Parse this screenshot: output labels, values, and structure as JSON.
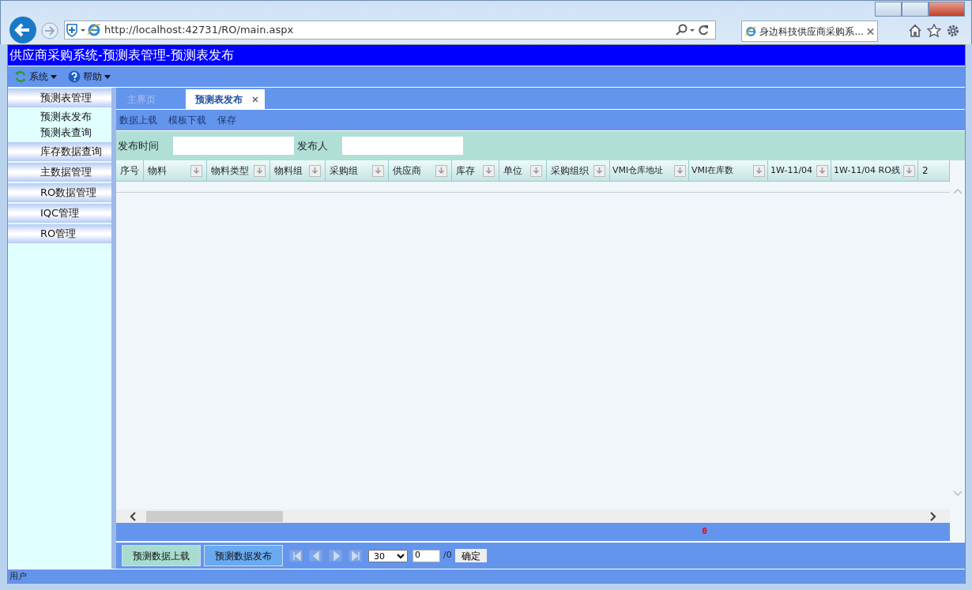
{
  "browser": {
    "url": "http://localhost:42731/RO/main.aspx",
    "tab_title": "身边科技供应商采购系..."
  },
  "app_title": "供应商采购系统-预测表管理-预测表发布",
  "menu": [
    {
      "label": "系统",
      "kind": "refresh"
    },
    {
      "label": "帮助",
      "kind": "help"
    }
  ],
  "sidebar": [
    {
      "label": "预测表管理",
      "children": [
        {
          "label": "预测表发布"
        },
        {
          "label": "预测表查询"
        }
      ]
    },
    {
      "label": "库存数据查询"
    },
    {
      "label": "主数据管理"
    },
    {
      "label": "RO数据管理"
    },
    {
      "label": "IQC管理"
    },
    {
      "label": "RO管理"
    }
  ],
  "tabs": [
    {
      "label": "主界页",
      "selected": false,
      "closable": false
    },
    {
      "label": "预测表发布",
      "selected": true,
      "closable": true
    }
  ],
  "toolbar": [
    "数据上载",
    "模板下载",
    "保存"
  ],
  "filters": [
    {
      "label": "发布时间"
    },
    {
      "label": "发布人"
    }
  ],
  "columns": [
    {
      "label": "序号",
      "has_menu": false
    },
    {
      "label": "物料",
      "has_menu": true
    },
    {
      "label": "物料类型",
      "has_menu": true
    },
    {
      "label": "物料组",
      "has_menu": true
    },
    {
      "label": "采购组",
      "has_menu": true
    },
    {
      "label": "供应商",
      "has_menu": true
    },
    {
      "label": "库存",
      "has_menu": true
    },
    {
      "label": "单位",
      "has_menu": true
    },
    {
      "label": "采购组织",
      "has_menu": true
    },
    {
      "label": "VMI仓库地址",
      "has_menu": true
    },
    {
      "label": "VMI在库数",
      "has_menu": true
    },
    {
      "label": "1W-11/04",
      "has_menu": true
    },
    {
      "label": "1W-11/04 RO残",
      "has_menu": true
    },
    {
      "label": "2",
      "has_menu": false
    }
  ],
  "footer_total": "0",
  "actions": [
    {
      "label": "预测数据上载",
      "selected": true
    },
    {
      "label": "预测数据发布",
      "selected": false
    }
  ],
  "pager": {
    "page_size": "30",
    "page": "0",
    "total": "/0",
    "confirm": "确定"
  },
  "status": "用户"
}
